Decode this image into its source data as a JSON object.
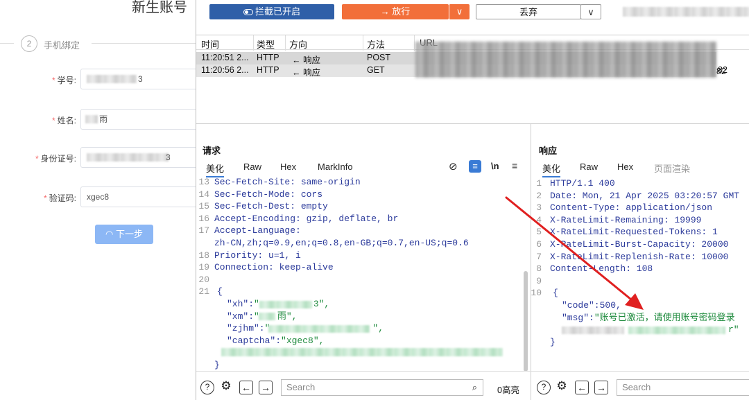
{
  "form": {
    "title": "新生账号",
    "step_number": "2",
    "step_label": "手机绑定",
    "fields": [
      {
        "label": "学号:",
        "value": "3"
      },
      {
        "label": "姓名:",
        "value": "雨"
      },
      {
        "label": "身份证号:",
        "value": "3"
      },
      {
        "label": "验证码:",
        "value": "xgec8"
      }
    ],
    "next_button": "下一步",
    "next_icon": "◠"
  },
  "toolbar": {
    "intercept_label": "拦截已开启",
    "forward_label": "→ 放行",
    "drop_label": "丢弃",
    "dropdown_arrow": "∨"
  },
  "grid": {
    "headers": [
      "时间",
      "类型",
      "方向",
      "方法",
      "URL"
    ],
    "rows": [
      {
        "time": "11:20:51 2...",
        "type": "HTTP",
        "direction": "← 响应",
        "method": "POST",
        "url_tail": ""
      },
      {
        "time": "11:20:56 2...",
        "type": "HTTP",
        "direction": "← 响应",
        "method": "GET",
        "url_tail": "82"
      }
    ]
  },
  "request": {
    "title": "请求",
    "tabs": [
      "美化",
      "Raw",
      "Hex",
      "MarkInfo"
    ],
    "toolbar_icons": [
      "⊘",
      "≡",
      "\\n",
      "≡"
    ],
    "lines": [
      {
        "n": "13",
        "text": "Sec-Fetch-Site: same-origin"
      },
      {
        "n": "14",
        "text": "Sec-Fetch-Mode: cors"
      },
      {
        "n": "15",
        "text": "Sec-Fetch-Dest: empty"
      },
      {
        "n": "16",
        "text": "Accept-Encoding: gzip, deflate, br"
      },
      {
        "n": "17",
        "text": "Accept-Language:"
      },
      {
        "n": "",
        "text": "zh-CN,zh;q=0.9,en;q=0.8,en-GB;q=0.7,en-US;q=0.6"
      },
      {
        "n": "18",
        "text": "Priority: u=1, i"
      },
      {
        "n": "19",
        "text": "Connection: keep-alive"
      },
      {
        "n": "20",
        "text": ""
      },
      {
        "n": "21",
        "text": "{"
      }
    ],
    "json_lines": [
      {
        "key": "\"xh\":",
        "val_head": "\"",
        "val_tail": "3\","
      },
      {
        "key": "\"xm\":",
        "val_head": "\"",
        "val_tail": "雨\","
      },
      {
        "key": "\"zjhm\":",
        "val_head": "\"",
        "val_tail": "\","
      },
      {
        "key": "\"captcha\":",
        "val_head": "\"xgec8\",",
        "val_tail": ""
      }
    ],
    "close_brace": "}",
    "search_placeholder": "Search",
    "highlight_count": "0高亮"
  },
  "response": {
    "title": "响应",
    "tabs": [
      "美化",
      "Raw",
      "Hex",
      "页面渲染"
    ],
    "lines": [
      {
        "n": "1",
        "text": "HTTP/1.1 400"
      },
      {
        "n": "2",
        "text": "Date: Mon, 21 Apr 2025 03:20:57 GMT"
      },
      {
        "n": "3",
        "text": "Content-Type: application/json"
      },
      {
        "n": "4",
        "text": "X-RateLimit-Remaining: 19999"
      },
      {
        "n": "5",
        "text": "X-RateLimit-Requested-Tokens: 1"
      },
      {
        "n": "6",
        "text": "X-RateLimit-Burst-Capacity: 20000"
      },
      {
        "n": "7",
        "text": "X-RateLimit-Replenish-Rate: 10000"
      },
      {
        "n": "8",
        "text": "Content-Length: 108"
      },
      {
        "n": "9",
        "text": ""
      },
      {
        "n": "10",
        "text": "{"
      }
    ],
    "code_line": "\"code\":500,",
    "msg_key": "\"msg\":",
    "msg_val": "\"账号已激活，请使用账号密码登录",
    "tail_val": "r\"",
    "close_brace": "}",
    "search_placeholder": "Search"
  },
  "colors": {
    "intercept_bg": "#2f5fa8",
    "forward_bg": "#f26f3a",
    "arrow": "#e02020",
    "string_green": "#1d8a3c",
    "code_blue": "#2b3a9b",
    "row_selected": "#d7d7d7"
  }
}
